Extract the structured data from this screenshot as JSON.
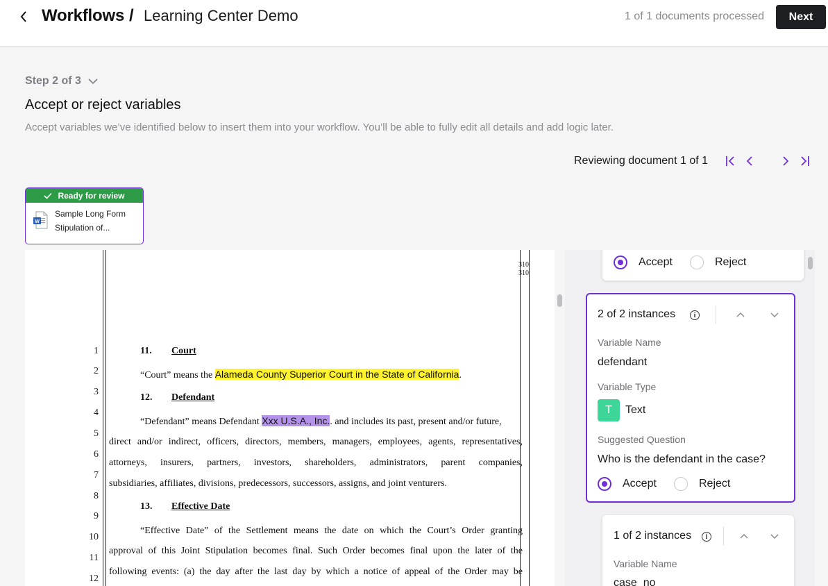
{
  "header": {
    "root": "Workflows",
    "separator": "/",
    "current": "Learning Center Demo",
    "processed": "1 of 1 documents processed",
    "next_label": "Next"
  },
  "step": {
    "label": "Step 2 of 3",
    "title": "Accept or reject variables",
    "subtitle": "Accept variables we’ve identified below to insert them into your workflow. You’ll be able to fully edit all details and add logic later."
  },
  "review": {
    "label": "Reviewing document 1 of 1"
  },
  "document_card": {
    "status": "Ready for review",
    "name_line1": "Sample Long Form",
    "name_line2": "Stipulation of..."
  },
  "document": {
    "page_marks": [
      "310",
      "310"
    ],
    "line_numbers": [
      "1",
      "2",
      "3",
      "4",
      "5",
      "6",
      "7",
      "8",
      "9",
      "10",
      "11",
      "12"
    ],
    "s11": {
      "num": "11.",
      "title": "Court"
    },
    "l2": {
      "pre": "“Court” means the ",
      "highlight": "Alameda County Superior Court in the State of California",
      "post": "."
    },
    "s12": {
      "num": "12.",
      "title": "Defendant"
    },
    "l4": {
      "pre": "“Defendant” means Defendant ",
      "highlight": "Xxx U.S.A., Inc.",
      "post": ". and includes its past, present and/or future,"
    },
    "l5": "direct and/or indirect, officers, directors, members, managers, employees, agents, representatives,",
    "l6": "attorneys, insurers, partners, investors, shareholders, administrators, parent companies,",
    "l7": "subsidiaries, affiliates, divisions, predecessors, successors, assigns, and joint venturers.",
    "s13": {
      "num": "13.",
      "title": "Effective Date"
    },
    "l10": "“Effective Date” of the Settlement means the date on which the Court’s Order granting",
    "l11": "approval of this Joint Stipulation becomes final.   Such Order becomes final upon the later of the",
    "l12": "following events: (a) the day after the last day by which a notice of appeal of the Order may be"
  },
  "panel": {
    "top_card": {
      "accept": "Accept",
      "reject": "Reject",
      "selected": "Accept"
    },
    "active_card": {
      "instances": "2 of 2 instances",
      "name_label": "Variable Name",
      "name_value": "defendant",
      "type_label": "Variable Type",
      "type_badge": "T",
      "type_value": "Text",
      "question_label": "Suggested Question",
      "question_value": "Who is the defendant in the case?",
      "accept": "Accept",
      "reject": "Reject",
      "selected": "Accept"
    },
    "next_card": {
      "instances": "1 of 2 instances",
      "name_label": "Variable Name",
      "name_value": "case_no"
    }
  },
  "colors": {
    "accent": "#6f2fd8",
    "status_green": "#2e9b47",
    "highlight_yellow": "#fdf22d",
    "highlight_purple": "#b492ea",
    "text_badge": "#3dd598",
    "primary_button": "#1e1f22"
  },
  "icons": [
    "chevron-left-icon",
    "chevron-down-icon",
    "check-icon",
    "word-doc-icon",
    "first-page-icon",
    "prev-page-icon",
    "next-page-icon",
    "last-page-icon",
    "info-icon",
    "chevron-up-icon"
  ]
}
